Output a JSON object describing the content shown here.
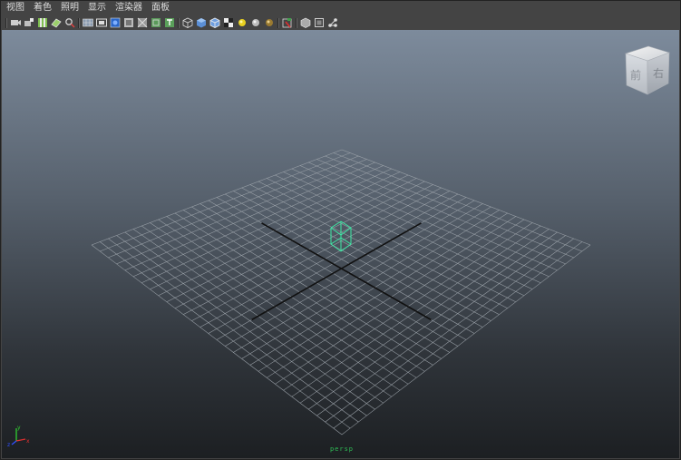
{
  "menu": {
    "view": "视图",
    "shading": "着色",
    "lighting": "照明",
    "show": "显示",
    "renderer": "渲染器",
    "panels": "面板"
  },
  "toolbar": {
    "groups": [
      [
        "select-camera-icon",
        "camera-attributes-icon",
        "bookmark-icon",
        "image-plane-icon",
        "two-d-pan-zoom-icon"
      ],
      [
        "grid-icon",
        "film-gate-icon",
        "resolution-gate-icon",
        "gate-mask-icon",
        "field-chart-icon",
        "safe-action-icon",
        "safe-title-icon"
      ],
      [
        "wireframe-icon",
        "smooth-shade-icon",
        "wireframe-on-shaded-icon",
        "textured-icon",
        "use-default-light-icon",
        "shadows-icon",
        "screen-space-ao-icon"
      ],
      [
        "isolate-select-icon"
      ],
      [
        "xray-icon",
        "xray-joints-icon",
        "xray-active-components-icon"
      ]
    ]
  },
  "viewcube": {
    "front_label": "前",
    "right_label": "右"
  },
  "axis": {
    "x_label": "x",
    "y_label": "y",
    "z_label": "z"
  },
  "viewport": {
    "camera_name": "persp"
  },
  "colors": {
    "grid_line": "#9aa1a8",
    "grid_axis": "#111111",
    "selected_object": "#3ee6a4",
    "axis_x": "#e03030",
    "axis_y": "#30d030",
    "axis_z": "#3050ff"
  }
}
